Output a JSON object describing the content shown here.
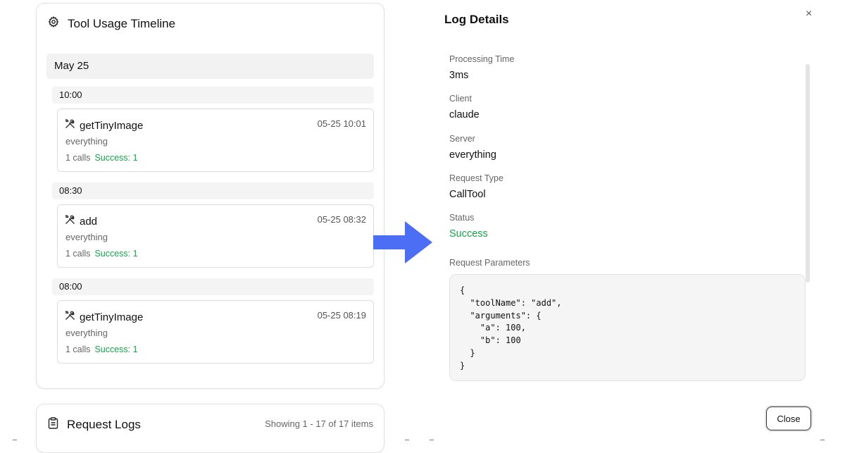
{
  "timeline": {
    "title": "Tool Usage Timeline",
    "icon": "gear-icon",
    "date_group": "May 25",
    "groups": [
      {
        "hour": "10:00",
        "entry": {
          "tool": "getTinyImage",
          "time": "05-25 10:01",
          "server": "everything",
          "calls": "1 calls",
          "success": "Success: 1"
        }
      },
      {
        "hour": "08:30",
        "entry": {
          "tool": "add",
          "time": "05-25 08:32",
          "server": "everything",
          "calls": "1 calls",
          "success": "Success: 1"
        }
      },
      {
        "hour": "08:00",
        "entry": {
          "tool": "getTinyImage",
          "time": "05-25 08:19",
          "server": "everything",
          "calls": "1 calls",
          "success": "Success: 1"
        }
      }
    ]
  },
  "request_logs": {
    "title": "Request Logs",
    "icon": "clipboard-icon",
    "count_text": "Showing 1 - 17 of 17 items"
  },
  "log_details": {
    "title": "Log Details",
    "close_x": "×",
    "fields": [
      {
        "label": "Processing Time",
        "value": "3ms"
      },
      {
        "label": "Client",
        "value": "claude"
      },
      {
        "label": "Server",
        "value": "everything"
      },
      {
        "label": "Request Type",
        "value": "CallTool"
      },
      {
        "label": "Status",
        "value": "Success"
      }
    ],
    "params_label": "Request Parameters",
    "params_json": "{\n  \"toolName\": \"add\",\n  \"arguments\": {\n    \"a\": 100,\n    \"b\": 100\n  }\n}",
    "close_button": "Close"
  },
  "colors": {
    "success": "#16a34a",
    "arrow": "#4c6ef5"
  }
}
